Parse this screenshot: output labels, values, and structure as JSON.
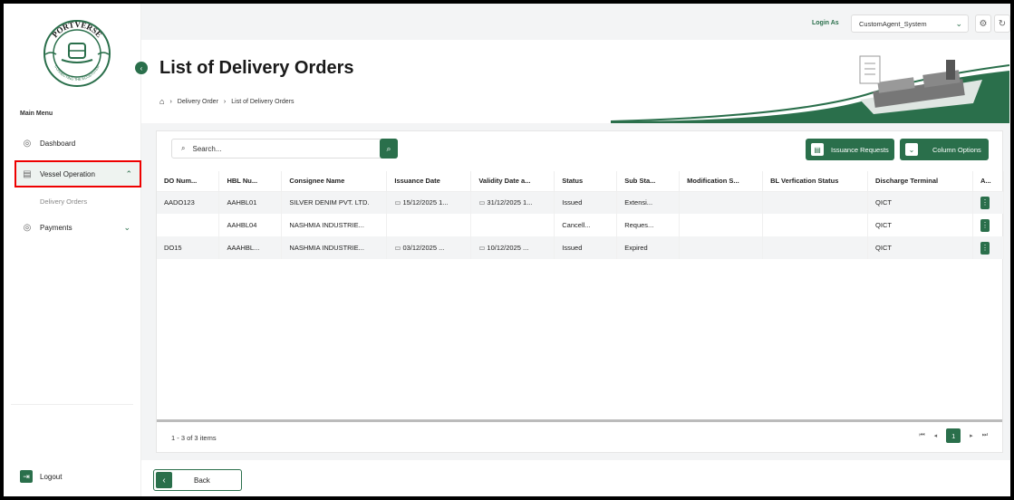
{
  "colors": {
    "accent": "#2a6f4b",
    "highlight_border": "#e00000"
  },
  "logo": {
    "text": "PORTVERSE",
    "tagline": "CONNECTING THE ECOSYSTEM"
  },
  "topbar": {
    "login_as": "Login As",
    "user": "CustomAgent_System",
    "icons": [
      "gear-icon",
      "refresh-icon"
    ]
  },
  "sidebar": {
    "main_menu": "Main Menu",
    "items": [
      {
        "label": "Dashboard",
        "icon": "dashboard-icon"
      },
      {
        "label": "Vessel Operation",
        "icon": "ship-icon"
      },
      {
        "label": "Payments",
        "icon": "payments-icon"
      }
    ],
    "submenu": "Delivery Orders",
    "logout": "Logout"
  },
  "header": {
    "title": "List of Delivery Orders",
    "breadcrumb": [
      "Delivery Order",
      "List of Delivery Orders"
    ]
  },
  "toolbar": {
    "search_placeholder": "Search...",
    "issuance_requests": "Issuance Requests",
    "column_options": "Column Options"
  },
  "table": {
    "columns": [
      "DO Num...",
      "HBL Nu...",
      "Consignee Name",
      "Issuance Date",
      "Validity Date a...",
      "Status",
      "Sub Sta...",
      "Modification S...",
      "BL Verfication Status",
      "Discharge Terminal",
      "A..."
    ],
    "rows": [
      [
        "AADO123",
        "AAHBL01",
        "SILVER DENIM PVT. LTD.",
        "15/12/2025 1...",
        "31/12/2025 1...",
        "Issued",
        "Extensi...",
        "",
        "",
        "QICT"
      ],
      [
        "",
        "AAHBL04",
        "NASHMIA INDUSTRIE...",
        "",
        "",
        "Cancell...",
        "Reques...",
        "",
        "",
        "QICT"
      ],
      [
        "DO15",
        "AAAHBL...",
        "NASHMIA INDUSTRIE...",
        "03/12/2025 ...",
        "10/12/2025 ...",
        "Issued",
        "Expired",
        "",
        "",
        "QICT"
      ]
    ]
  },
  "pagination": {
    "summary": "1 - 3 of 3 items",
    "current_page": "1"
  },
  "footer": {
    "back": "Back"
  }
}
